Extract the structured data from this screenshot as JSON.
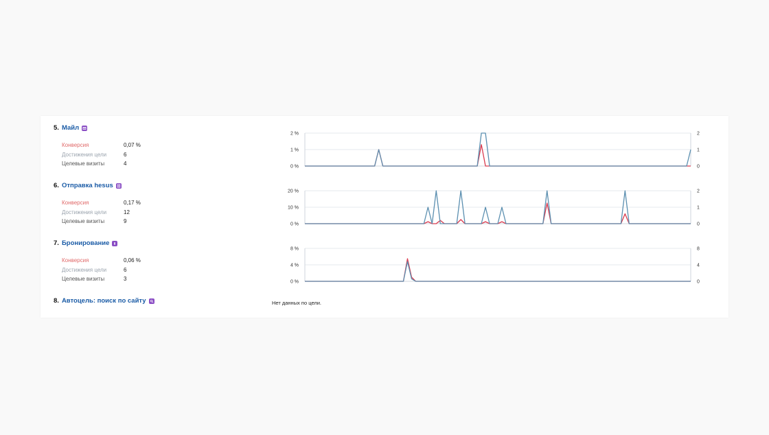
{
  "colors": {
    "link": "#1a5ba6",
    "conversion_line": "#d93a4e",
    "visits_line": "#5b8fb0",
    "conversion_label": "#e06969",
    "achievements_label": "#9aa3ad",
    "visits_label": "#555555",
    "goal_icon": "#8a4dc4"
  },
  "goals": [
    {
      "number": "5.",
      "name": "Майл",
      "icon": "mail-icon",
      "metrics": [
        {
          "label": "Конверсия",
          "value": "0,07 %"
        },
        {
          "label": "Достижения цели",
          "value": "6"
        },
        {
          "label": "Целевые визиты",
          "value": "4"
        }
      ]
    },
    {
      "number": "6.",
      "name": "Отправка hesus",
      "icon": "form-icon",
      "metrics": [
        {
          "label": "Конверсия",
          "value": "0,17 %"
        },
        {
          "label": "Достижения цели",
          "value": "12"
        },
        {
          "label": "Целевые визиты",
          "value": "9"
        }
      ]
    },
    {
      "number": "7.",
      "name": "Бронирование",
      "icon": "booking-icon",
      "metrics": [
        {
          "label": "Конверсия",
          "value": "0,06 %"
        },
        {
          "label": "Достижения цели",
          "value": "6"
        },
        {
          "label": "Целевые визиты",
          "value": "3"
        }
      ]
    },
    {
      "number": "8.",
      "name": "Автоцель: поиск по сайту",
      "icon": "search-icon",
      "no_data": "Нет данных по цели."
    }
  ],
  "chart_data": [
    {
      "type": "line",
      "x_count": 95,
      "y_left_ticks": [
        "2 %",
        "1 %",
        "0 %"
      ],
      "y_right_ticks": [
        "2",
        "1",
        "0"
      ],
      "y_left_lim": [
        0,
        2
      ],
      "y_right_lim": [
        0,
        2
      ],
      "grid": true,
      "series": [
        {
          "axis": "left",
          "color": "#d93a4e",
          "points": [
            [
              18,
              1.0
            ],
            [
              43,
              1.3
            ]
          ]
        },
        {
          "axis": "right",
          "color": "#5b8fb0",
          "points": [
            [
              18,
              1
            ],
            [
              43,
              2
            ],
            [
              44,
              2
            ],
            [
              94,
              1
            ]
          ]
        }
      ]
    },
    {
      "type": "line",
      "x_count": 95,
      "y_left_ticks": [
        "20 %",
        "10 %",
        "0 %"
      ],
      "y_right_ticks": [
        "2",
        "1",
        "0"
      ],
      "y_left_lim": [
        0,
        20
      ],
      "y_right_lim": [
        0,
        2
      ],
      "grid": true,
      "series": [
        {
          "axis": "left",
          "color": "#d93a4e",
          "points": [
            [
              30,
              1.2
            ],
            [
              33,
              2.0
            ],
            [
              38,
              2.5
            ],
            [
              44,
              1.2
            ],
            [
              48,
              1.2
            ],
            [
              59,
              12.5
            ],
            [
              78,
              6.0
            ]
          ]
        },
        {
          "axis": "right",
          "color": "#5b8fb0",
          "points": [
            [
              30,
              1
            ],
            [
              32,
              2
            ],
            [
              38,
              2
            ],
            [
              44,
              1
            ],
            [
              48,
              1
            ],
            [
              59,
              2
            ],
            [
              78,
              2
            ]
          ]
        }
      ]
    },
    {
      "type": "line",
      "x_count": 95,
      "y_left_ticks": [
        "8 %",
        "4 %",
        "0 %"
      ],
      "y_right_ticks": [
        "8",
        "4",
        "0"
      ],
      "y_left_lim": [
        0,
        8
      ],
      "y_right_lim": [
        0,
        8
      ],
      "grid": true,
      "series": [
        {
          "axis": "left",
          "color": "#d93a4e",
          "points": [
            [
              25,
              5.5
            ],
            [
              26,
              1.0
            ]
          ]
        },
        {
          "axis": "right",
          "color": "#5b8fb0",
          "points": [
            [
              25,
              4.8
            ],
            [
              26,
              0.6
            ]
          ]
        }
      ]
    }
  ]
}
